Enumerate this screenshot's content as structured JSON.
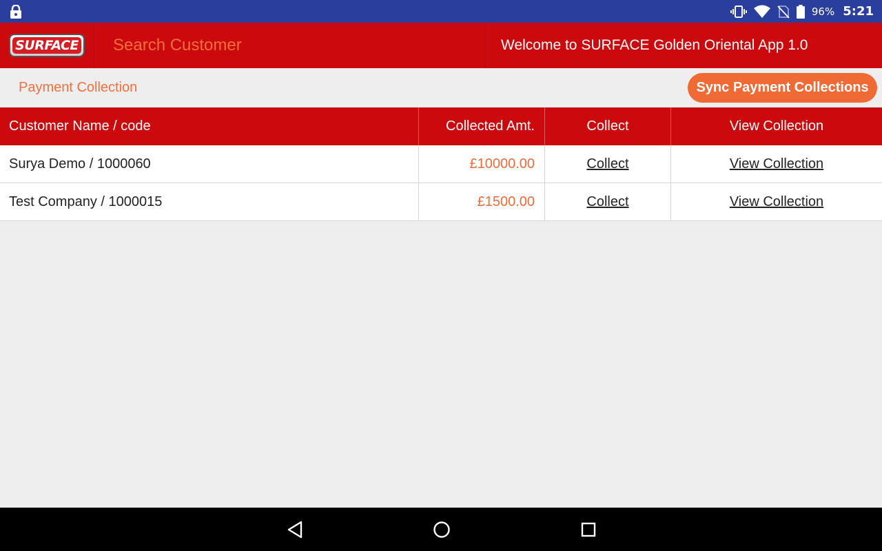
{
  "status_bar": {
    "battery_percent": "96%",
    "time": "5:21",
    "icons": [
      "lock-icon",
      "vibrate-icon",
      "wifi-icon",
      "no-sim-icon",
      "battery-icon"
    ]
  },
  "header": {
    "logo_text": "SURFACE",
    "search_placeholder": "Search Customer",
    "welcome_text": "Welcome to SURFACE Golden Oriental App 1.0"
  },
  "page": {
    "title": "Payment Collection",
    "sync_button_label": "Sync Payment Collections"
  },
  "table": {
    "columns": [
      "Customer Name / code",
      "Collected Amt.",
      "Collect",
      "View Collection"
    ],
    "rows": [
      {
        "customer": "Surya Demo / 1000060",
        "amount": "£10000.00",
        "collect": "Collect",
        "view": "View Collection"
      },
      {
        "customer": "Test Company / 1000015",
        "amount": "£1500.00",
        "collect": "Collect",
        "view": "View Collection"
      }
    ]
  },
  "nav_bar": {
    "icons": [
      "back-icon",
      "home-icon",
      "recents-icon"
    ]
  },
  "colors": {
    "status_bar": "#2a3e9e",
    "primary_red": "#cc0a0e",
    "accent_orange": "#f06a36",
    "background": "#eeeeee"
  }
}
